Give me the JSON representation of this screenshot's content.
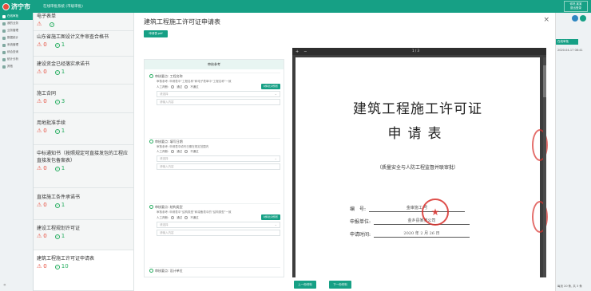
{
  "app": {
    "name": "济宁市",
    "system_title": "在线审批系统 (市级审批)",
    "user_lines": [
      "你好,某某",
      "退出登录"
    ]
  },
  "sidenav": {
    "items": [
      {
        "label": "在线审批"
      },
      {
        "label": "我的业务"
      },
      {
        "label": "业务管理"
      },
      {
        "label": "数据统计"
      },
      {
        "label": "系统管理"
      },
      {
        "label": "综合查询"
      },
      {
        "label": "统计分析"
      },
      {
        "label": "其他"
      }
    ],
    "collapse": "«"
  },
  "right_strip": {
    "text1": "在线审批",
    "text2": "2020-04-17 08:41",
    "footer": "每页 20 条, 共 3 条"
  },
  "doc_list": [
    {
      "title": "电子表单",
      "warn": "",
      "ok": "",
      "warn_icon": true
    },
    {
      "title": "山东省施工图设计文件审查合格书",
      "warn": "0",
      "ok": "1"
    },
    {
      "title": "建设资金已经落实承诺书",
      "warn": "0",
      "ok": "1"
    },
    {
      "title": "施工合同",
      "warn": "0",
      "ok": "3"
    },
    {
      "title": "用地批准手续",
      "warn": "0",
      "ok": "1"
    },
    {
      "title": "中标通知书（按照规定可直接发包的工程应直接发包备案表）",
      "warn": "0",
      "ok": "1"
    },
    {
      "title": "直接施工条件承诺书",
      "warn": "0",
      "ok": "1"
    },
    {
      "title": "建设工程规划许可证",
      "warn": "0",
      "ok": "1"
    },
    {
      "title": "建筑工程施工许可证申请表",
      "warn": "0",
      "ok": "10"
    }
  ],
  "main": {
    "title": "建筑工程施工许可证申请表",
    "file_button": "申请表.pdf",
    "review_header": "审核参考",
    "sections": [
      {
        "title": "审核要点: 工程名称",
        "ref": "审核参考: 申请表中“工程名称”和电子表单中“工程名称”一致",
        "radio_label": "人工判断:",
        "pass": "通过",
        "fail": "不通过",
        "attach": "材料比对预览",
        "select_ph": "请选择",
        "input_ph": "请输入内容"
      },
      {
        "title": "审核要点: 填写日期",
        "ref": "审核参考: 申请表中填写日期在规定范围内",
        "radio_label": "人工判断:",
        "pass": "通过",
        "fail": "不通过",
        "attach": "",
        "select_ph": "请选择",
        "input_ph": "请输入内容"
      },
      {
        "title": "审核要点: 结构类型",
        "ref": "审核参考: 申请表中“结构类型”和竣备表中的“结构类型”一致",
        "radio_label": "人工判断:",
        "pass": "通过",
        "fail": "不通过",
        "attach": "材料比对预览",
        "select_ph": "请选择",
        "input_ph": "请输入内容"
      },
      {
        "title": "审核要点: 设计单位"
      }
    ]
  },
  "pdf": {
    "page_indicator": "1 / 3",
    "heading1": "建筑工程施工许可证",
    "heading2": "申请表",
    "subtitle": "（质量安全与人防工程监督并联审批）",
    "rows": [
      {
        "label": "编　号:",
        "value": "金审施工 号"
      },
      {
        "label": "申报单位:",
        "value": "金乡县某某公司"
      },
      {
        "label": "申请时间:",
        "value": "2020 年 2 月 26 日"
      }
    ],
    "seal_char": "★"
  },
  "footer": {
    "prev_label": "上一份材料",
    "next_label": "下一份材料"
  },
  "colors": {
    "brand": "#16a085",
    "warn": "#e74c3c",
    "ok": "#27ae60"
  }
}
